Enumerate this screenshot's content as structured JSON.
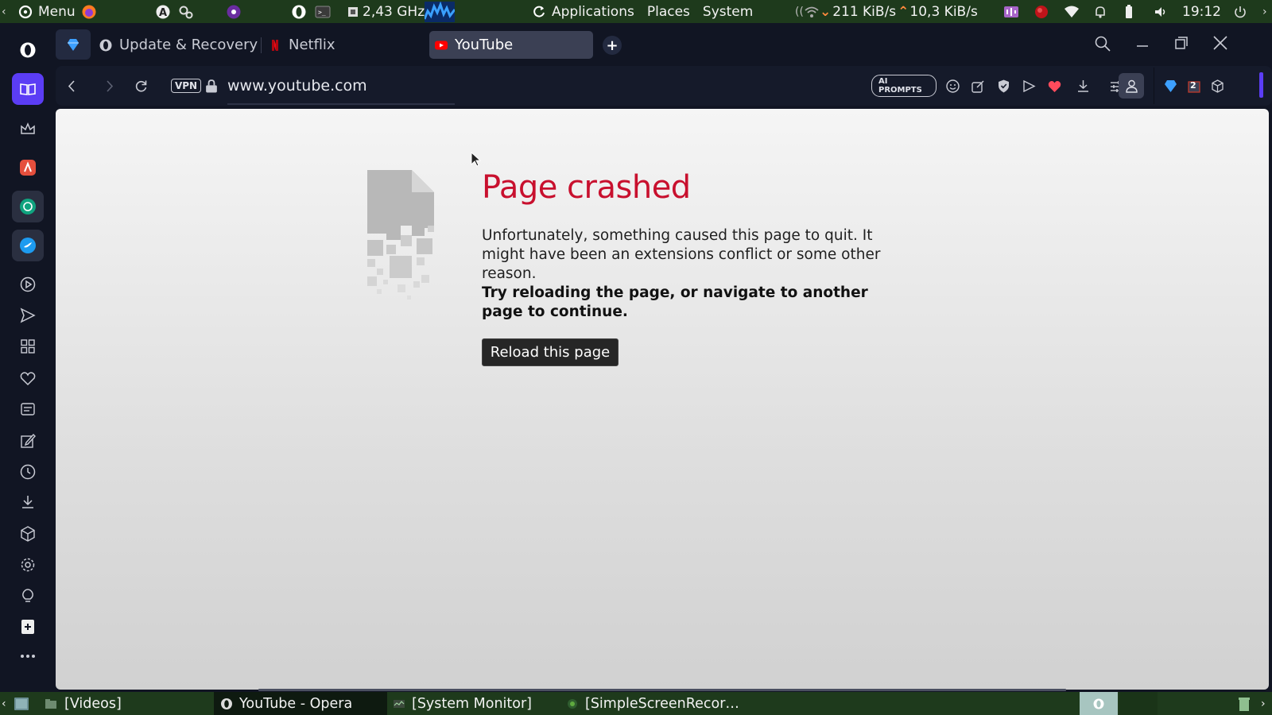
{
  "top_panel": {
    "menu_label": "Menu",
    "cpu_freq": "2,43 GHz",
    "places": [
      "Applications",
      "Places",
      "System"
    ],
    "net_down": "211 KiB/s",
    "net_up": "10,3 KiB/s",
    "clock": "19:12"
  },
  "tabs": [
    {
      "label": "Update & Recovery",
      "icon": "opera-icon",
      "active": false
    },
    {
      "label": "Netflix",
      "icon": "netflix-icon",
      "active": false
    },
    {
      "label": "YouTube",
      "icon": "youtube-icon",
      "active": true
    }
  ],
  "address_bar": {
    "vpn_label": "VPN",
    "url": "www.youtube.com",
    "ai_prompts_label": "AI PROMPTS",
    "badge_count": "2"
  },
  "crash_page": {
    "title": "Page crashed",
    "description": "Unfortunately, something caused this page to quit. It might have been an extensions conflict or some other reason.",
    "hint": "Try reloading the page, or navigate to another page to continue.",
    "reload_button": "Reload this page"
  },
  "bottom_panel": {
    "tasks": [
      "[Videos]",
      "YouTube - Opera",
      "[System Monitor]",
      "[SimpleScreenRecor…"
    ]
  },
  "colors": {
    "panel_green": "#1e3a1c",
    "window_bg": "#111523",
    "crash_title_red": "#c8102e",
    "active_tab": "#3b4054",
    "workspace_active": "#a7c5c0"
  }
}
